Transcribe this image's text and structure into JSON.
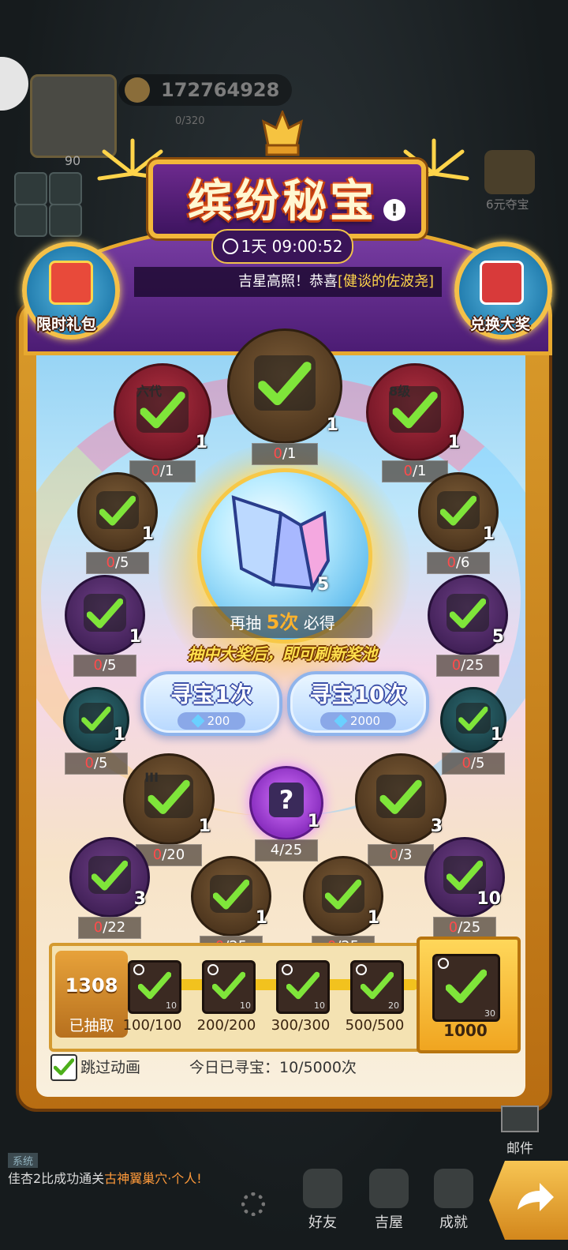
{
  "header": {
    "title": "缤纷秘宝",
    "timer": "1天 09:00:52",
    "announcement_prefix": "吉星高照！恭喜",
    "announcement_name": "[健谈的佐波尧]",
    "left_button": "限时礼包",
    "right_button": "兑换大奖"
  },
  "background": {
    "currency": "172764928",
    "stamina": "0/320",
    "level": "90",
    "side_event": "6元夺宝"
  },
  "grand_prize": {
    "count": "5",
    "draw_prefix": "再抽",
    "draw_count": "5次",
    "draw_suffix": "必得",
    "hint": "抽中大奖后，即可刷新奖池"
  },
  "buttons": {
    "single": {
      "label": "寻宝1次",
      "cost": "200"
    },
    "ten": {
      "label": "寻宝10次",
      "cost": "2000"
    }
  },
  "prizes": [
    {
      "id": "top-left",
      "count": "1",
      "progress_got": "0",
      "progress_total": "/1",
      "color": "red",
      "text": "六代"
    },
    {
      "id": "top-center",
      "count": "1",
      "progress_got": "0",
      "progress_total": "/1",
      "color": "brown"
    },
    {
      "id": "top-right",
      "count": "1",
      "progress_got": "0",
      "progress_total": "/1",
      "color": "red",
      "text": "8级"
    },
    {
      "id": "left-1",
      "count": "1",
      "progress_got": "0",
      "progress_total": "/5",
      "color": "brown"
    },
    {
      "id": "right-1",
      "count": "1",
      "progress_got": "0",
      "progress_total": "/6",
      "color": "brown"
    },
    {
      "id": "left-2",
      "count": "1",
      "progress_got": "0",
      "progress_total": "/5",
      "color": "purple"
    },
    {
      "id": "right-2",
      "count": "5",
      "progress_got": "0",
      "progress_total": "/25",
      "color": "purple"
    },
    {
      "id": "left-3",
      "count": "1",
      "progress_got": "0",
      "progress_total": "/5",
      "color": "teal"
    },
    {
      "id": "right-3",
      "count": "1",
      "progress_got": "0",
      "progress_total": "/5",
      "color": "teal"
    },
    {
      "id": "mid-left",
      "count": "1",
      "progress_got": "0",
      "progress_total": "/20",
      "color": "brown",
      "text": "III"
    },
    {
      "id": "mystery",
      "count": "1",
      "progress_got": "4",
      "progress_total": "/25",
      "color": "magenta"
    },
    {
      "id": "mid-right",
      "count": "3",
      "progress_got": "0",
      "progress_total": "/3",
      "color": "brown"
    },
    {
      "id": "bottom-1",
      "count": "3",
      "progress_got": "0",
      "progress_total": "/22",
      "color": "purple"
    },
    {
      "id": "bottom-2",
      "count": "1",
      "progress_got": "0",
      "progress_total": "/25",
      "color": "brown"
    },
    {
      "id": "bottom-3",
      "count": "1",
      "progress_got": "0",
      "progress_total": "/25",
      "color": "brown"
    },
    {
      "id": "bottom-4",
      "count": "10",
      "progress_got": "0",
      "progress_total": "/25",
      "color": "purple"
    }
  ],
  "milestones": {
    "total": "1308",
    "total_label": "已抽取",
    "items": [
      {
        "num": "10",
        "progress": "100/100"
      },
      {
        "num": "10",
        "progress": "200/200"
      },
      {
        "num": "10",
        "progress": "300/300"
      },
      {
        "num": "20",
        "progress": "500/500"
      }
    ],
    "final": {
      "num": "30",
      "progress": "1000"
    }
  },
  "footer": {
    "skip_label": "跳过动画",
    "today": "今日已寻宝：10/5000次"
  },
  "hud": {
    "chat_tag": "系统",
    "chat_prefix": "佳杏2比成功通关",
    "chat_place": "古神翼巢穴·个人!",
    "btn_friends": "好友",
    "btn_house": "吉屋",
    "btn_achieve": "成就",
    "btn_mail": "邮件"
  }
}
